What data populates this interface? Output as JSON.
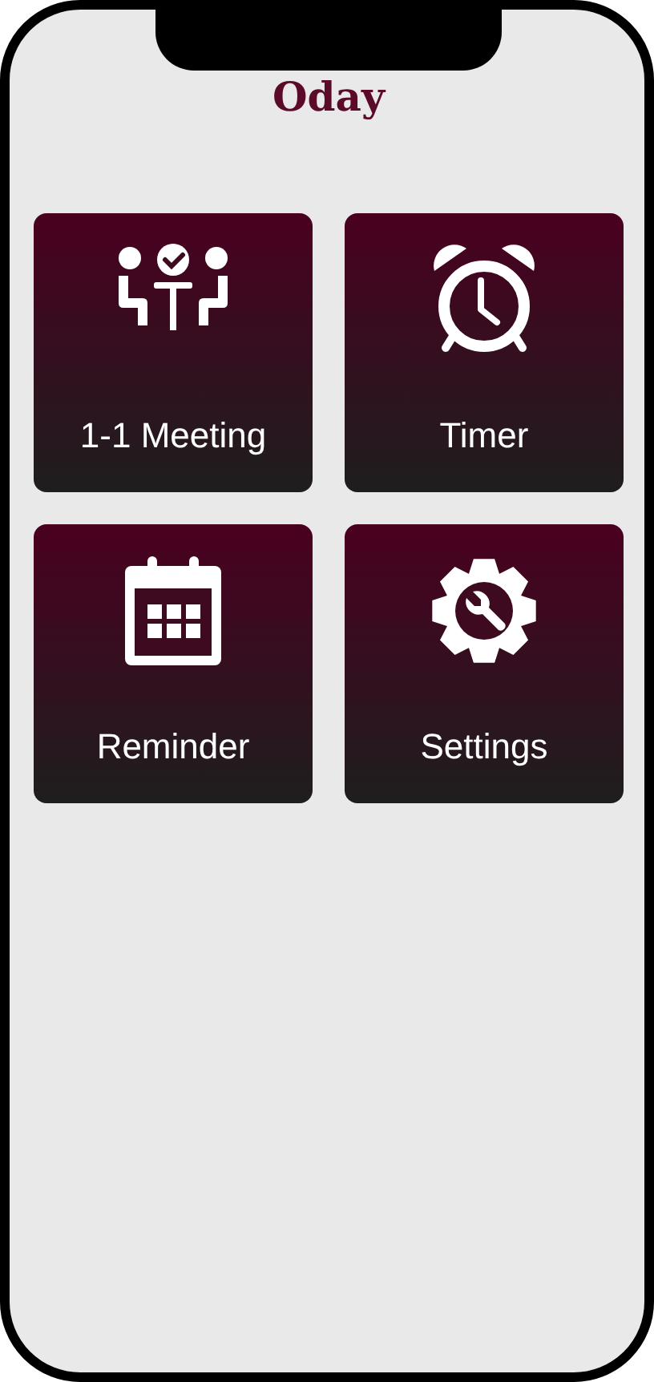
{
  "app": {
    "title": "Oday"
  },
  "tiles": [
    {
      "label": "1-1 Meeting",
      "kind": "meeting"
    },
    {
      "label": "Timer",
      "kind": "alarm"
    },
    {
      "label": "Reminder",
      "kind": "calendar"
    },
    {
      "label": "Settings",
      "kind": "gear"
    }
  ]
}
